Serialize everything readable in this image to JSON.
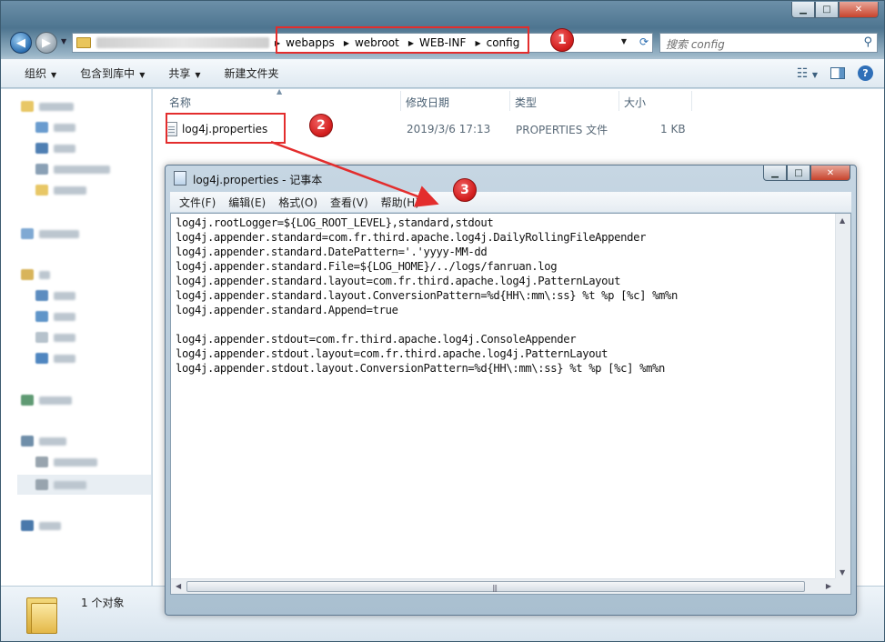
{
  "explorer": {
    "breadcrumb": [
      "webapps",
      "webroot",
      "WEB-INF",
      "config"
    ],
    "search_placeholder": "搜索 config",
    "toolbar": {
      "organize": "组织",
      "include_library": "包含到库中",
      "share": "共享",
      "new_folder": "新建文件夹"
    },
    "columns": {
      "name": "名称",
      "modified": "修改日期",
      "type": "类型",
      "size": "大小"
    },
    "files": [
      {
        "name": "log4j.properties",
        "modified": "2019/3/6 17:13",
        "type": "PROPERTIES 文件",
        "size": "1 KB"
      }
    ],
    "status": "1 个对象"
  },
  "notepad": {
    "title": "log4j.properties - 记事本",
    "menu": [
      "文件(F)",
      "编辑(E)",
      "格式(O)",
      "查看(V)",
      "帮助(H)"
    ],
    "content": [
      "log4j.rootLogger=${LOG_ROOT_LEVEL},standard,stdout",
      "log4j.appender.standard=com.fr.third.apache.log4j.DailyRollingFileAppender",
      "log4j.appender.standard.DatePattern='.'yyyy-MM-dd",
      "log4j.appender.standard.File=${LOG_HOME}/../logs/fanruan.log",
      "log4j.appender.standard.layout=com.fr.third.apache.log4j.PatternLayout",
      "log4j.appender.standard.layout.ConversionPattern=%d{HH\\:mm\\:ss} %t %p [%c] %m%n",
      "log4j.appender.standard.Append=true",
      "",
      "log4j.appender.stdout=com.fr.third.apache.log4j.ConsoleAppender",
      "log4j.appender.stdout.layout=com.fr.third.apache.log4j.PatternLayout",
      "log4j.appender.stdout.layout.ConversionPattern=%d{HH\\:mm\\:ss} %t %p [%c] %m%n"
    ]
  },
  "annotations": [
    "1",
    "2",
    "3"
  ],
  "colors": {
    "annotation": "#e32d2d",
    "explorer_frame": "#4e7590"
  }
}
